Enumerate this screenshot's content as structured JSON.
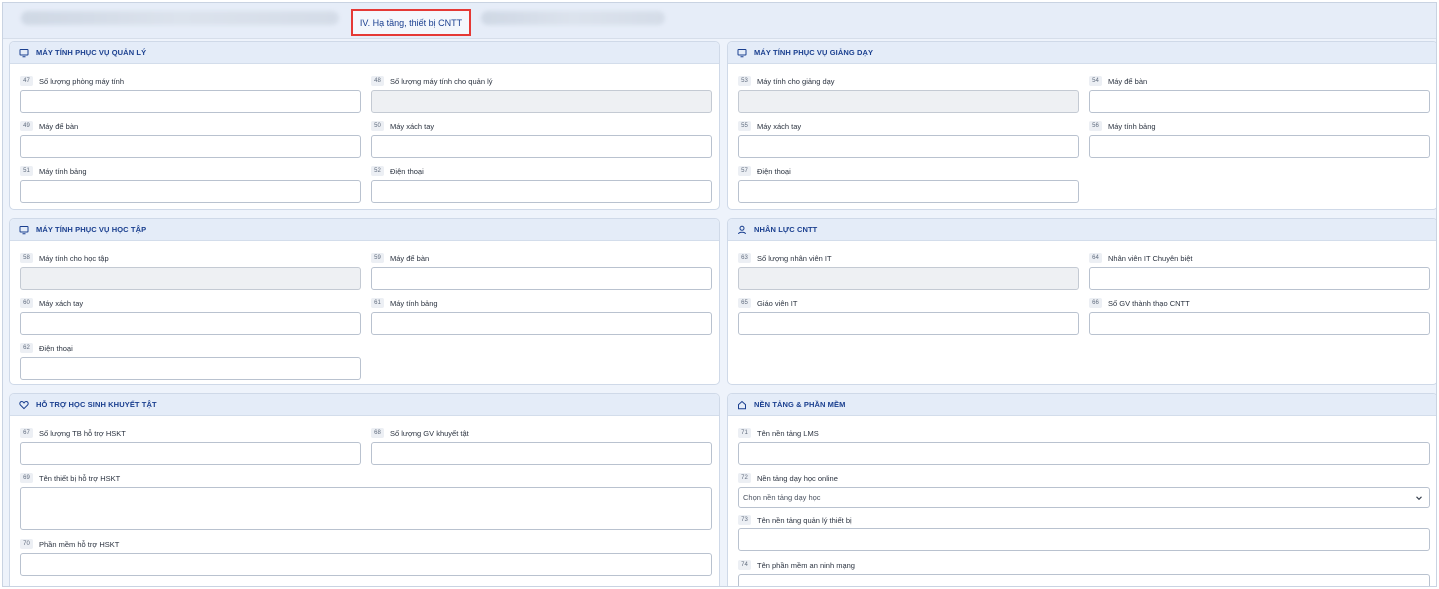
{
  "tabs": {
    "active_label": "IV. Hạ tầng, thiết bị CNTT"
  },
  "panels": {
    "ql": {
      "title": "MÁY TÍNH PHỤC VỤ QUẢN LÝ",
      "fields": [
        {
          "num": "47",
          "label": "Số lượng phòng máy tính"
        },
        {
          "num": "48",
          "label": "Số lượng máy tính cho quản lý"
        },
        {
          "num": "49",
          "label": "Máy để bàn"
        },
        {
          "num": "50",
          "label": "Máy xách tay"
        },
        {
          "num": "51",
          "label": "Máy tính bảng"
        },
        {
          "num": "52",
          "label": "Điện thoại"
        }
      ]
    },
    "gd": {
      "title": "MÁY TÍNH PHỤC VỤ GIẢNG DẠY",
      "fields": [
        {
          "num": "53",
          "label": "Máy tính cho giảng dạy"
        },
        {
          "num": "54",
          "label": "Máy để bàn"
        },
        {
          "num": "55",
          "label": "Máy xách tay"
        },
        {
          "num": "56",
          "label": "Máy tính bảng"
        },
        {
          "num": "57",
          "label": "Điện thoại"
        }
      ]
    },
    "ht": {
      "title": "MÁY TÍNH PHỤC VỤ HỌC TẬP",
      "fields": [
        {
          "num": "58",
          "label": "Máy tính cho học tập"
        },
        {
          "num": "59",
          "label": "Máy để bàn"
        },
        {
          "num": "60",
          "label": "Máy xách tay"
        },
        {
          "num": "61",
          "label": "Máy tính bảng"
        },
        {
          "num": "62",
          "label": "Điện thoại"
        }
      ]
    },
    "nl": {
      "title": "NHÂN LỰC CNTT",
      "fields": [
        {
          "num": "63",
          "label": "Số lượng nhân viên IT"
        },
        {
          "num": "64",
          "label": "Nhân viên IT Chuyên biệt"
        },
        {
          "num": "65",
          "label": "Giáo viên IT"
        },
        {
          "num": "66",
          "label": "Số GV thành thạo CNTT"
        }
      ]
    },
    "kt": {
      "title": "HỖ TRỢ HỌC SINH KHUYẾT TẬT",
      "fields": [
        {
          "num": "67",
          "label": "Số lượng TB hỗ trợ HSKT"
        },
        {
          "num": "68",
          "label": "Số lượng GV khuyết tật"
        },
        {
          "num": "69",
          "label": "Tên thiết bị hỗ trợ HSKT"
        },
        {
          "num": "70",
          "label": "Phần mềm hỗ trợ HSKT"
        }
      ]
    },
    "pm": {
      "title": "NỀN TẢNG & PHẦN MỀM",
      "fields": [
        {
          "num": "71",
          "label": "Tên nền tảng LMS"
        },
        {
          "num": "72",
          "label": "Nền tảng dạy học online"
        },
        {
          "num": "73",
          "label": "Tên nền tảng quản lý thiết bị"
        },
        {
          "num": "74",
          "label": "Tên phần mềm an ninh mạng"
        }
      ],
      "select_placeholder": "Chọn nền tảng dạy học"
    }
  },
  "icons": {
    "ql": "monitor-icon",
    "gd": "monitor-icon",
    "ht": "monitor-icon",
    "nl": "user-icon",
    "kt": "heart-icon",
    "pm": "house-icon",
    "select": "chevron-down-icon"
  },
  "colors": {
    "accent": "#1a3f8f",
    "highlight": "#e53935"
  }
}
